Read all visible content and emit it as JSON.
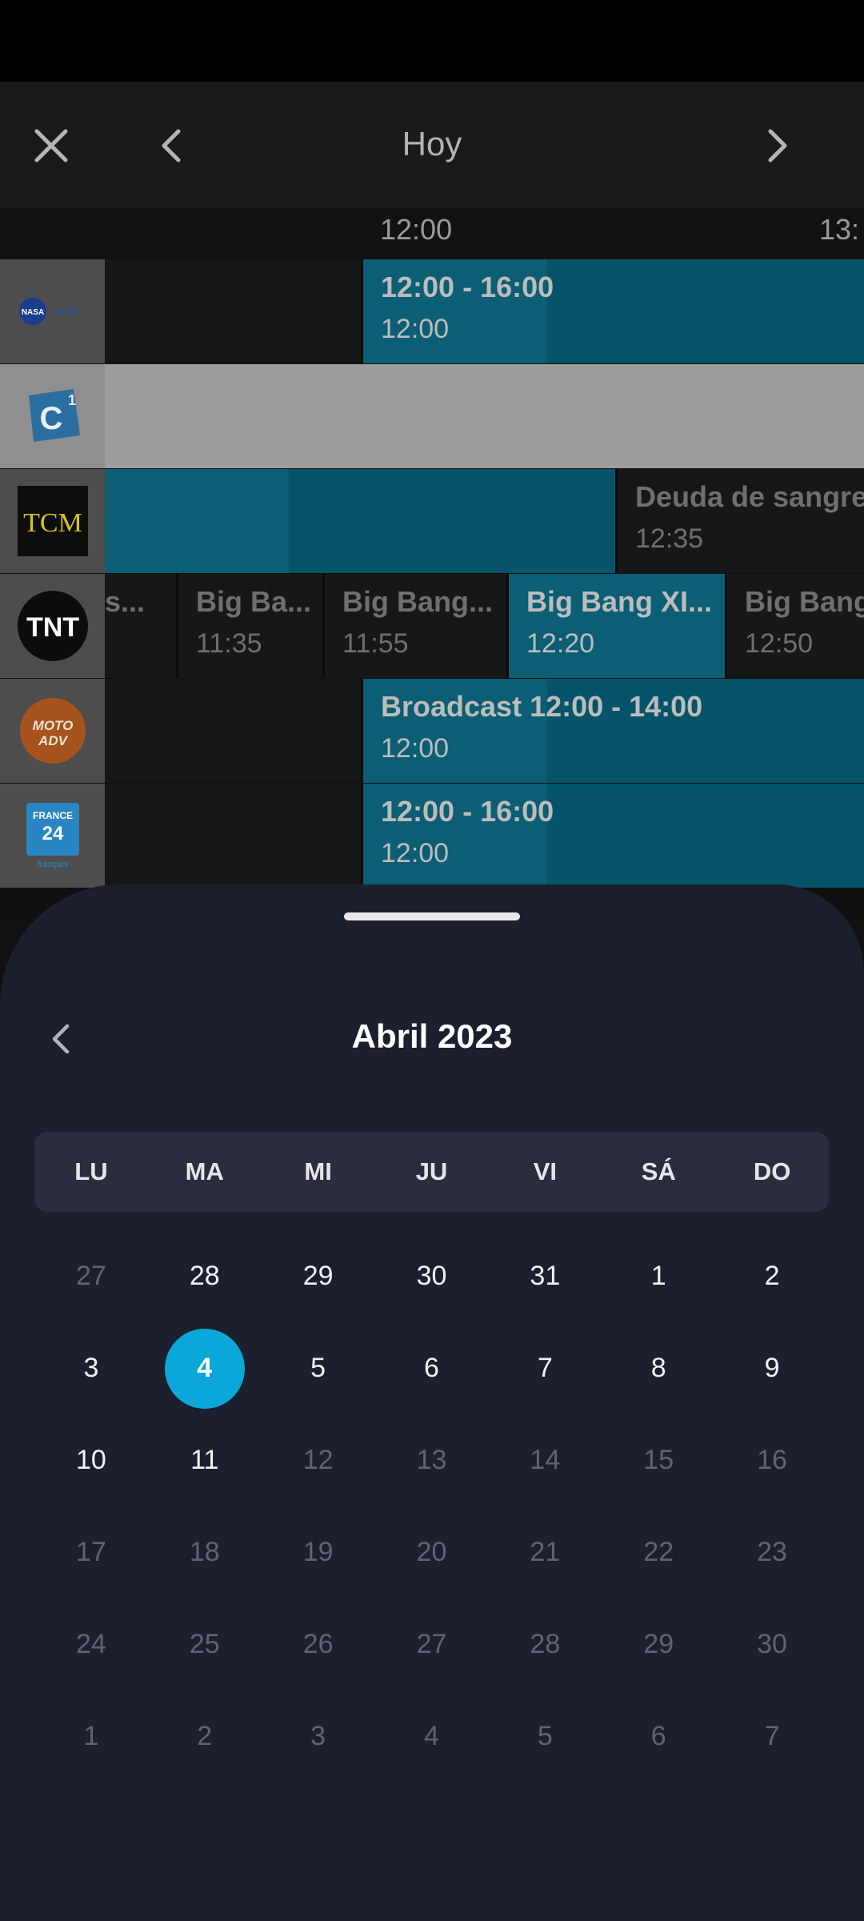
{
  "header": {
    "title": "Hoy"
  },
  "timeline": {
    "labels": [
      "12:00",
      "13:"
    ]
  },
  "channels": [
    {
      "name": "NASA UHD",
      "logo_text_a": "NASA",
      "logo_text_b": "UHD",
      "programs": [
        {
          "time": "12:00 - 16:00",
          "start": "12:00",
          "style": "blue now"
        }
      ]
    },
    {
      "name": "C1",
      "logo_text": "C",
      "logo_sup": "1",
      "programs": []
    },
    {
      "name": "TCM",
      "logo_text": "TCM",
      "programs": [
        {
          "title": "Deuda de sangre",
          "start": "12:35",
          "style": "dark"
        }
      ]
    },
    {
      "name": "TNT",
      "logo_text": "TNT",
      "programs": [
        {
          "title": "s...",
          "start": ""
        },
        {
          "title": "Big Ba...",
          "start": "11:35"
        },
        {
          "title": "Big Bang...",
          "start": "11:55"
        },
        {
          "title": "Big Bang XI...",
          "start": "12:20"
        },
        {
          "title": "Big Bang",
          "start": "12:50"
        }
      ]
    },
    {
      "name": "MOTO ADV",
      "logo_text_a": "MOTO",
      "logo_text_b": "ADV",
      "programs": [
        {
          "title": "Broadcast 12:00 - 14:00",
          "start": "12:00"
        }
      ]
    },
    {
      "name": "FRANCE 24 français",
      "logo_text_a": "FRANCE",
      "logo_text_b": "24",
      "logo_text_c": "français",
      "programs": [
        {
          "time": "12:00 - 16:00",
          "start": "12:00"
        }
      ]
    }
  ],
  "calendar": {
    "month_title": "Abril  2023",
    "weekdays": [
      "LU",
      "MA",
      "MI",
      "JU",
      "VI",
      "SÁ",
      "DO"
    ],
    "days": [
      {
        "d": "27",
        "state": "muted"
      },
      {
        "d": "28",
        "state": "active"
      },
      {
        "d": "29",
        "state": "active"
      },
      {
        "d": "30",
        "state": "active"
      },
      {
        "d": "31",
        "state": "active"
      },
      {
        "d": "1",
        "state": "active"
      },
      {
        "d": "2",
        "state": "active"
      },
      {
        "d": "3",
        "state": "active"
      },
      {
        "d": "4",
        "state": "selected"
      },
      {
        "d": "5",
        "state": "active"
      },
      {
        "d": "6",
        "state": "active"
      },
      {
        "d": "7",
        "state": "active"
      },
      {
        "d": "8",
        "state": "active"
      },
      {
        "d": "9",
        "state": "active"
      },
      {
        "d": "10",
        "state": "active"
      },
      {
        "d": "11",
        "state": "active"
      },
      {
        "d": "12",
        "state": "muted"
      },
      {
        "d": "13",
        "state": "muted"
      },
      {
        "d": "14",
        "state": "muted"
      },
      {
        "d": "15",
        "state": "muted"
      },
      {
        "d": "16",
        "state": "muted"
      },
      {
        "d": "17",
        "state": "muted"
      },
      {
        "d": "18",
        "state": "muted"
      },
      {
        "d": "19",
        "state": "muted"
      },
      {
        "d": "20",
        "state": "muted"
      },
      {
        "d": "21",
        "state": "muted"
      },
      {
        "d": "22",
        "state": "muted"
      },
      {
        "d": "23",
        "state": "muted"
      },
      {
        "d": "24",
        "state": "muted"
      },
      {
        "d": "25",
        "state": "muted"
      },
      {
        "d": "26",
        "state": "muted"
      },
      {
        "d": "27",
        "state": "muted"
      },
      {
        "d": "28",
        "state": "muted"
      },
      {
        "d": "29",
        "state": "muted"
      },
      {
        "d": "30",
        "state": "muted"
      },
      {
        "d": "1",
        "state": "muted"
      },
      {
        "d": "2",
        "state": "muted"
      },
      {
        "d": "3",
        "state": "muted"
      },
      {
        "d": "4",
        "state": "muted"
      },
      {
        "d": "5",
        "state": "muted"
      },
      {
        "d": "6",
        "state": "muted"
      },
      {
        "d": "7",
        "state": "muted"
      }
    ]
  },
  "colors": {
    "accent": "#0aa7d8",
    "sheet_bg": "#1c1f2d",
    "weekday_bar": "#292d3e",
    "program_blue": "#06596f"
  },
  "icons": [
    "close-icon",
    "chevron-left-icon",
    "chevron-right-icon"
  ]
}
